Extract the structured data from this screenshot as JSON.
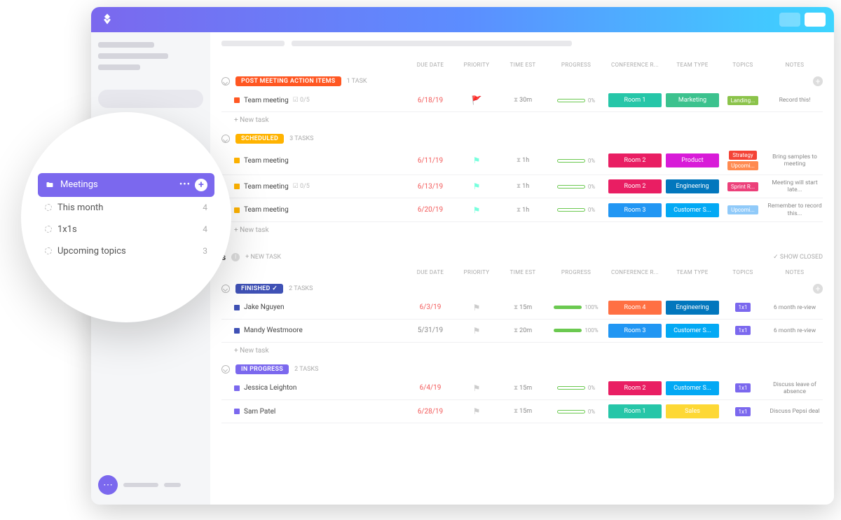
{
  "columns": {
    "name": "",
    "due": "DUE DATE",
    "priority": "PRIORITY",
    "time": "TIME EST",
    "progress": "PROGRESS",
    "room": "CONFERENCE R...",
    "team": "TEAM TYPE",
    "topics": "TOPICS",
    "notes": "NOTES"
  },
  "newTask": "+ New task",
  "showClosed": "SHOW CLOSED",
  "newTaskHeader": "+ NEW TASK",
  "popover": {
    "title": "Meetings",
    "items": [
      {
        "label": "This month",
        "count": "4"
      },
      {
        "label": "1x1s",
        "count": "4"
      },
      {
        "label": "Upcoming topics",
        "count": "3"
      }
    ]
  },
  "sections": [
    {
      "status": "POST MEETING ACTION ITEMS",
      "statusColor": "#ff5722",
      "count": "1 TASK",
      "showHeader": true,
      "tasks": [
        {
          "sq": "#ff5722",
          "name": "Team meeting",
          "check": "0/5",
          "due": "6/18/19",
          "dueOk": false,
          "flag": "🚩",
          "flagColor": "#f25",
          "time": "30m",
          "progress": 0,
          "open": true,
          "room": "Room 1",
          "roomColor": "#26c6a8",
          "team": "Marketing",
          "teamColor": "#3cc28e",
          "topics": [
            {
              "t": "Landing...",
              "c": "#8bc34a"
            }
          ],
          "notes": "Record this!"
        }
      ]
    },
    {
      "status": "SCHEDULED",
      "statusColor": "#ffb300",
      "count": "3 TASKS",
      "showHeader": false,
      "tasks": [
        {
          "sq": "#ffb300",
          "name": "Team meeting",
          "due": "6/11/19",
          "dueOk": false,
          "flag": "⚑",
          "flagColor": "#7fd",
          "time": "1h",
          "progress": 0,
          "open": true,
          "room": "Room 2",
          "roomColor": "#e91e63",
          "team": "Product",
          "teamColor": "#d81bd8",
          "topics": [
            {
              "t": "Strategy",
              "c": "#f44336"
            },
            {
              "t": "Upcomi...",
              "c": "#ff8a50"
            }
          ],
          "notes": "Bring samples to meeting"
        },
        {
          "sq": "#ffb300",
          "name": "Team meeting",
          "check": "0/5",
          "due": "6/13/19",
          "dueOk": false,
          "flag": "⚑",
          "flagColor": "#7fd",
          "time": "1h",
          "progress": 0,
          "open": true,
          "room": "Room 2",
          "roomColor": "#e91e63",
          "team": "Engineering",
          "teamColor": "#0277bd",
          "topics": [
            {
              "t": "Sprint R...",
              "c": "#ec407a"
            }
          ],
          "notes": "Meeting will start late..."
        },
        {
          "sq": "#ffb300",
          "name": "Team meeting",
          "due": "6/20/19",
          "dueOk": false,
          "flag": "⚑",
          "flagColor": "#7fd",
          "time": "1h",
          "progress": 0,
          "open": true,
          "room": "Room 3",
          "roomColor": "#2196f3",
          "team": "Customer S...",
          "teamColor": "#03a9f4",
          "topics": [
            {
              "t": "Upcomi...",
              "c": "#90caf9"
            }
          ],
          "notes": "Remember to record this..."
        }
      ]
    }
  ],
  "list2": {
    "titleSuffix": "s",
    "sections": [
      {
        "status": "FINISHED",
        "statusColor": "#3f51b5",
        "count": "2 TASKS",
        "showHeader": true,
        "checkIcon": true,
        "tasks": [
          {
            "sq": "#3f51b5",
            "name": "Jake Nguyen",
            "due": "6/3/19",
            "dueOk": false,
            "flag": "⚑",
            "flagColor": "#ccc",
            "time": "15m",
            "progress": 100,
            "room": "Room 4",
            "roomColor": "#ff7043",
            "team": "Engineering",
            "teamColor": "#0277bd",
            "topics": [
              {
                "t": "1x1",
                "c": "#7b68ee"
              }
            ],
            "notes": "6 month re-view"
          },
          {
            "sq": "#3f51b5",
            "name": "Mandy Westmoore",
            "due": "5/31/19",
            "dueOk": true,
            "flag": "⚑",
            "flagColor": "#ccc",
            "time": "20m",
            "progress": 100,
            "room": "Room 3",
            "roomColor": "#2196f3",
            "team": "Customer S...",
            "teamColor": "#03a9f4",
            "topics": [
              {
                "t": "1x1",
                "c": "#7b68ee"
              }
            ],
            "notes": "6 month re-view"
          }
        ]
      },
      {
        "status": "IN PROGRESS",
        "statusColor": "#7b68ee",
        "count": "2 TASKS",
        "showHeader": false,
        "tasks": [
          {
            "sq": "#7b68ee",
            "name": "Jessica Leighton",
            "due": "6/4/19",
            "dueOk": false,
            "flag": "⚑",
            "flagColor": "#ccc",
            "time": "15m",
            "progress": 0,
            "open": true,
            "room": "Room 2",
            "roomColor": "#e91e63",
            "team": "Customer S...",
            "teamColor": "#03a9f4",
            "topics": [
              {
                "t": "1x1",
                "c": "#7b68ee"
              }
            ],
            "notes": "Discuss leave of absence"
          },
          {
            "sq": "#7b68ee",
            "name": "Sam Patel",
            "due": "6/28/19",
            "dueOk": false,
            "flag": "⚑",
            "flagColor": "#ccc",
            "time": "15m",
            "progress": 0,
            "open": true,
            "room": "Room 1",
            "roomColor": "#26c6a8",
            "team": "Sales",
            "teamColor": "#fdd835",
            "topics": [
              {
                "t": "1x1",
                "c": "#7b68ee"
              }
            ],
            "notes": "Discuss Pepsi deal"
          }
        ]
      }
    ]
  }
}
